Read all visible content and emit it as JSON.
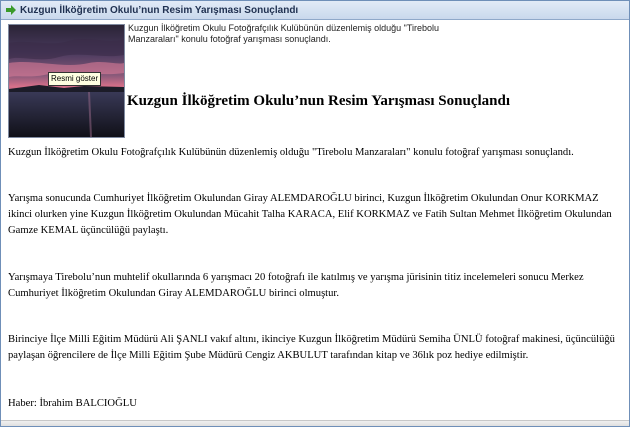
{
  "window": {
    "title": "Kuzgun İlköğretim Okulu’nun Resim Yarışması Sonuçlandı"
  },
  "thumbnail": {
    "tooltip": "Resmi göster"
  },
  "summary": "Kuzgun İlköğretim Okulu Fotoğrafçılık Kulübünün düzenlemiş olduğu \"Tirebolu Manzaraları\" konulu fotoğraf yarışması sonuçlandı.",
  "article": {
    "heading": "Kuzgun İlköğretim Okulu’nun Resim Yarışması Sonuçlandı",
    "paragraphs": [
      "Kuzgun İlköğretim Okulu Fotoğrafçılık Kulübünün düzenlemiş olduğu \"Tirebolu Manzaraları\" konulu fotoğraf yarışması sonuçlandı.",
      "Yarışma sonucunda Cumhuriyet İlköğretim Okulundan Giray ALEMDAROĞLU birinci, Kuzgun İlköğretim Okulundan Onur KORKMAZ ikinci olurken yine Kuzgun İlköğretim Okulundan Mücahit Talha KARACA, Elif KORKMAZ ve Fatih Sultan Mehmet İlköğretim Okulundan Gamze KEMAL üçüncülüğü paylaştı.",
      "Yarışmaya Tirebolu’nun muhtelif okullarında 6 yarışmacı 20 fotoğrafı ile katılmış ve yarışma jürisinin titiz incelemeleri sonucu Merkez Cumhuriyet İlköğretim Okulundan Giray ALEMDAROĞLU birinci olmuştur.",
      "Birinciye İlçe Milli Eğitim Müdürü Ali ŞANLI vakıf altını, ikinciye Kuzgun İlköğretim Müdürü Semiha ÜNLÜ fotoğraf makinesi, üçüncülüğü paylaşan öğrencilere de  İlçe Milli Eğitim Şube Müdürü Cengiz AKBULUT tarafından kitap ve 36lık poz hediye edilmiştir.",
      "Haber: İbrahim BALCIOĞLU"
    ]
  },
  "icons": {
    "title_arrow": "green-right-arrow-icon"
  },
  "colors": {
    "title_bar": "#c9d8ec",
    "arrow": "#3a9a2a",
    "tooltip_bg": "#ffffe1"
  }
}
